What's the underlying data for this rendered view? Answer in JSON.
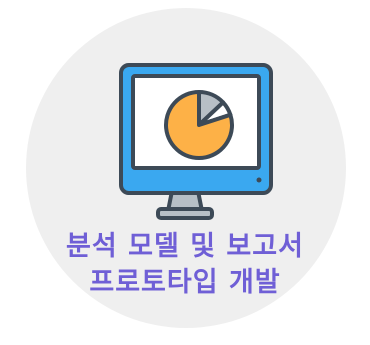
{
  "caption": {
    "line1": "분석 모델 및 보고서",
    "line2": "프로토타입 개발"
  },
  "icon": "monitor-pie-chart-icon",
  "colors": {
    "background_circle": "#efefef",
    "monitor_frame": "#3aa8f0",
    "outline": "#3d4a57",
    "screen": "#ffffff",
    "pie_main": "#fdb147",
    "pie_slice_gray": "#b7bfc6",
    "stand": "#b7bfc6",
    "text": "#6f5fd6"
  },
  "chart_data": {
    "type": "pie",
    "slices": [
      {
        "value": 80
      },
      {
        "value": 13
      },
      {
        "value": 7
      }
    ]
  }
}
